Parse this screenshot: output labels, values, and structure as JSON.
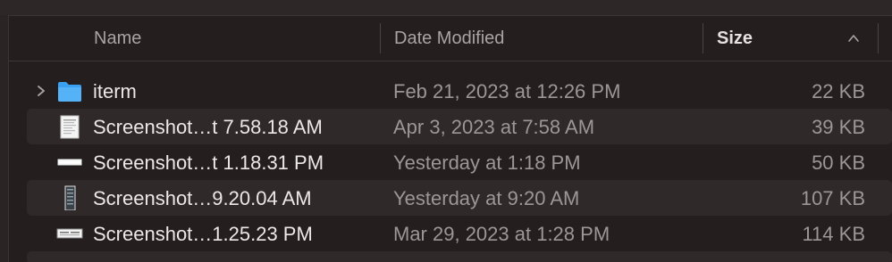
{
  "columns": {
    "name": "Name",
    "date_modified": "Date Modified",
    "size": "Size"
  },
  "sort": {
    "column": "size",
    "direction": "ascending",
    "icon": "chevron-up-icon"
  },
  "rows": [
    {
      "name": "iterm",
      "date": "Feb 21, 2023 at 12:26 PM",
      "size": "22 KB",
      "kind": "folder",
      "icon": "folder-icon"
    },
    {
      "name": "Screenshot…t 7.58.18 AM",
      "date": "Apr 3, 2023 at 7:58 AM",
      "size": "39 KB",
      "kind": "image",
      "icon": "document-thumbnail-icon"
    },
    {
      "name": "Screenshot…t 1.18.31 PM",
      "date": "Yesterday at 1:18 PM",
      "size": "50 KB",
      "kind": "image",
      "icon": "wide-thumbnail-icon"
    },
    {
      "name": "Screenshot…9.20.04 AM",
      "date": "Yesterday at 9:20 AM",
      "size": "107 KB",
      "kind": "image",
      "icon": "tall-thumbnail-icon"
    },
    {
      "name": "Screenshot…1.25.23 PM",
      "date": "Mar 29, 2023 at 1:28 PM",
      "size": "114 KB",
      "kind": "image",
      "icon": "wide-thumbnail-icon"
    }
  ],
  "colors": {
    "background": "#241e1e",
    "alt_row": "#2f2929",
    "folder": "#3aa0f2",
    "text": "#ece8e8",
    "muted_text": "#9c9797"
  }
}
